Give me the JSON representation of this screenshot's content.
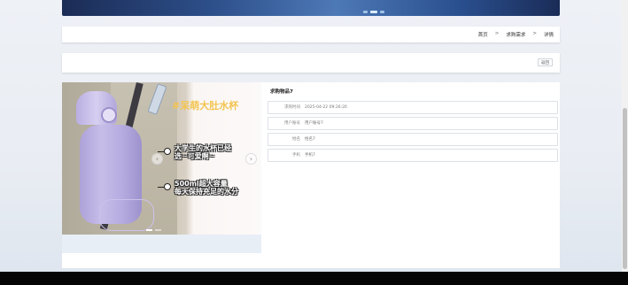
{
  "breadcrumb": {
    "home": "首页",
    "sep1": ">",
    "section": "求购需求",
    "sep2": ">",
    "current": "详情"
  },
  "actions": {
    "back_label": "返回"
  },
  "detail": {
    "title": "求购物品7",
    "fields": [
      {
        "label": "求购时间",
        "value": "2025-04-22 09:26:20"
      },
      {
        "label": "用户账号",
        "value": "用户账号7"
      },
      {
        "label": "姓名",
        "value": "姓名7"
      },
      {
        "label": "手机",
        "value": "手机7"
      }
    ]
  },
  "image": {
    "headline": "#呆萌大肚水杯",
    "feature_1_line1": "大学生的水杯已经",
    "feature_1_line2": "选~可爱啊~",
    "feature_2_line1": "500ml超大容量",
    "feature_2_line2": "每天保持充足的水分"
  },
  "colors": {
    "banner": "#2d4f8a",
    "headline": "#f3c451",
    "bottle": "#c7bde9"
  },
  "icons": {
    "carousel_next": "chevron-right-icon",
    "carousel_prev": "chevron-left-icon"
  }
}
